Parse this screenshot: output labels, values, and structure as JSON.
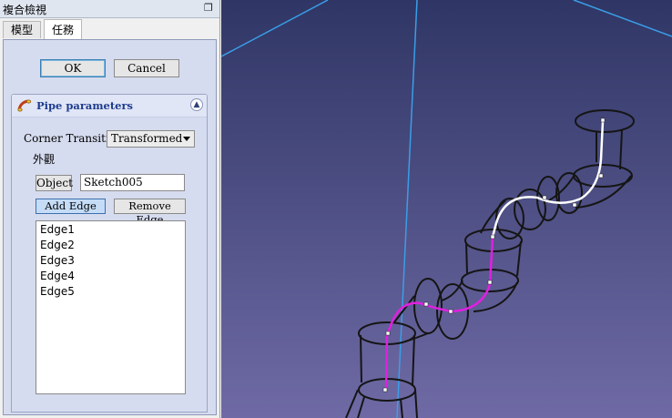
{
  "window": {
    "title": "複合檢視",
    "restore_icon": "restore-window-icon"
  },
  "tabs": [
    {
      "label": "模型"
    },
    {
      "label": "任務"
    }
  ],
  "dialog": {
    "ok_label": "OK",
    "cancel_label": "Cancel"
  },
  "pipe": {
    "title": "Pipe parameters",
    "icon": "pipe-icon",
    "collapse_icon": "collapse-icon",
    "corner_transition_label": "Corner Transition",
    "corner_transition_value": "Transformed",
    "appearance_label": "外觀",
    "object_button_label": "Object",
    "object_value": "Sketch005",
    "add_edge_label": "Add Edge",
    "remove_edge_label": "Remove Edge",
    "edges": [
      "Edge1",
      "Edge2",
      "Edge3",
      "Edge4",
      "Edge5"
    ]
  },
  "colors": {
    "background_top": "#2f3665",
    "background_bottom": "#6f6aa5",
    "axis_blue": "#3a9ee8",
    "wire": "#151515",
    "path_selected": "#e020e0",
    "path_unselected": "#ffffff"
  }
}
